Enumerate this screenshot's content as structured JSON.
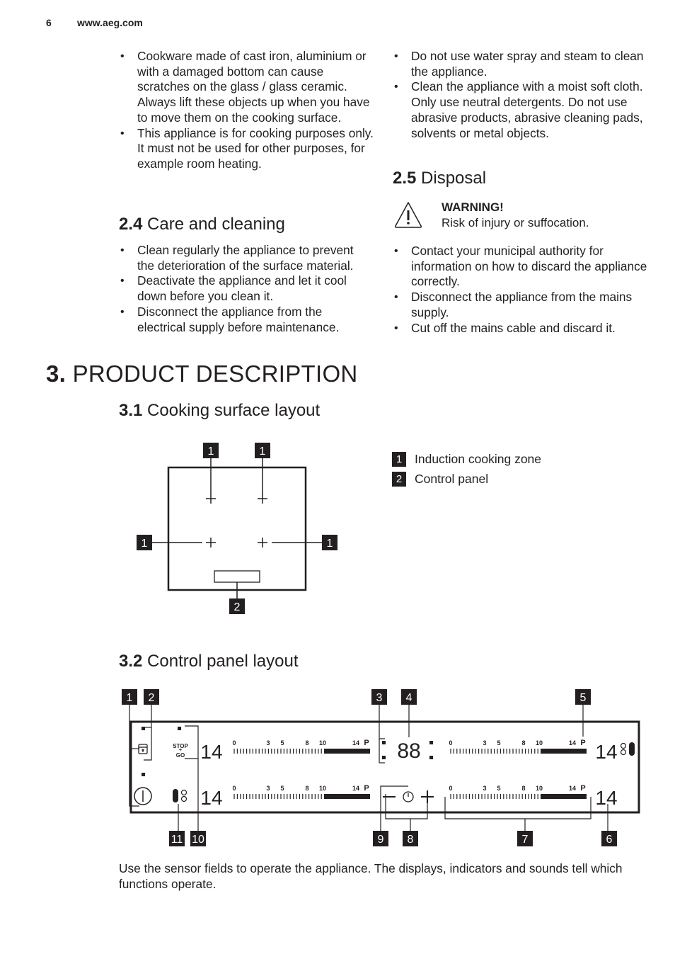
{
  "header": {
    "page_number": "6",
    "url": "www.aeg.com"
  },
  "left_column": {
    "intro_bullets": [
      "Cookware made of cast iron, aluminium or with a damaged bottom can cause scratches on the glass / glass ceramic. Always lift these objects up when you have to move them on the cooking surface.",
      "This appliance is for cooking purposes only. It must not be used for other purposes, for example room heating."
    ],
    "section_2_4": {
      "number": "2.4",
      "title": "Care and cleaning",
      "bullets": [
        "Clean regularly the appliance to prevent the deterioration of the surface material.",
        "Deactivate the appliance and let it cool down before you clean it.",
        "Disconnect the appliance from the electrical supply before maintenance."
      ]
    }
  },
  "right_column": {
    "intro_bullets": [
      "Do not use water spray and steam to clean the appliance.",
      "Clean the appliance with a moist soft cloth. Only use neutral detergents. Do not use abrasive products, abrasive cleaning pads, solvents or metal objects."
    ],
    "section_2_5": {
      "number": "2.5",
      "title": "Disposal",
      "warning": {
        "icon": "warning-triangle-icon",
        "title": "WARNING!",
        "text": "Risk of injury or suffocation."
      },
      "bullets": [
        "Contact your municipal authority for information on how to discard the appliance correctly.",
        "Disconnect the appliance from the mains supply.",
        "Cut off the mains cable and discard it."
      ]
    }
  },
  "chapter_3": {
    "number": "3.",
    "title": "PRODUCT DESCRIPTION",
    "section_3_1": {
      "number": "3.1",
      "title": "Cooking surface layout",
      "callouts": {
        "zone": "1",
        "panel": "2"
      },
      "legend": [
        {
          "badge": "1",
          "label": "Induction cooking zone"
        },
        {
          "badge": "2",
          "label": "Control panel"
        }
      ]
    },
    "section_3_2": {
      "number": "3.2",
      "title": "Control panel layout",
      "callouts": [
        "1",
        "2",
        "3",
        "4",
        "5",
        "6",
        "7",
        "8",
        "9",
        "10",
        "11"
      ],
      "panel": {
        "power_level_display": "14",
        "timer_display": "88",
        "stop_go_label_top": "STOP",
        "stop_go_label_bottom": "GO",
        "slider_scale": [
          "0",
          "3",
          "5",
          "8",
          "10",
          "14",
          "P"
        ]
      },
      "description": "Use the sensor fields to operate the appliance. The displays, indicators and sounds tell which functions operate."
    }
  }
}
